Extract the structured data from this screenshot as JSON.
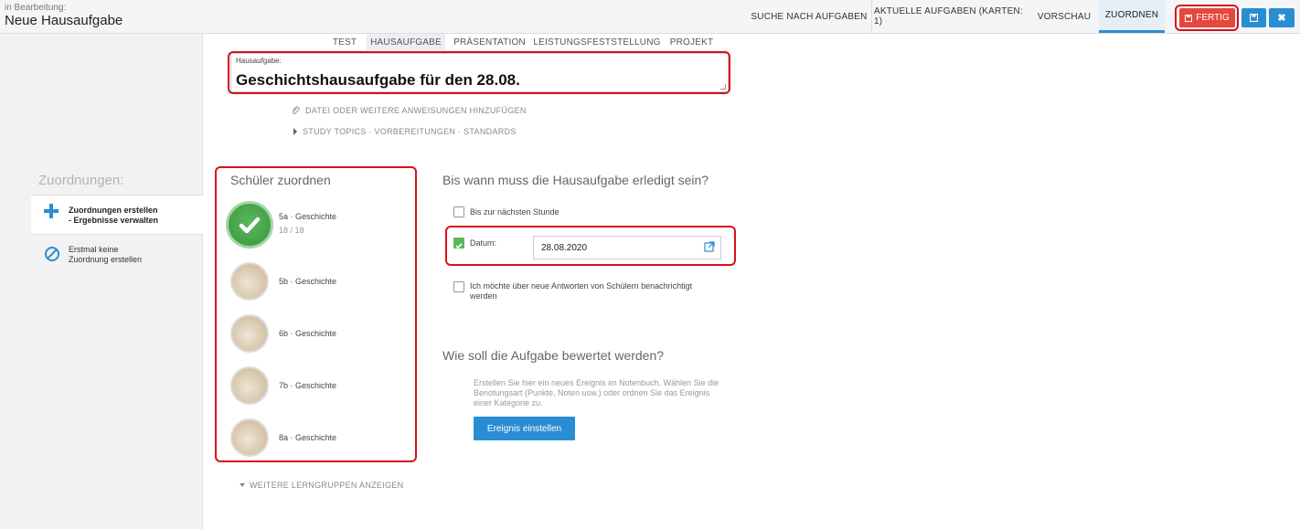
{
  "header": {
    "edit_status": "in Bearbeitung:",
    "title": "Neue Hausaufgabe",
    "nav": [
      {
        "label": "SUCHE NACH AUFGABEN"
      },
      {
        "label": "AKTUELLE AUFGABEN (KARTEN: 1)"
      },
      {
        "label": "VORSCHAU"
      },
      {
        "label": "ZUORDNEN",
        "active": true
      }
    ],
    "done_label": "FERTIG",
    "save_icon": "floppy-disk-icon",
    "close_icon": "close-icon"
  },
  "type_tabs": [
    {
      "label": "TEST"
    },
    {
      "label": "HAUSAUFGABE",
      "active": true
    },
    {
      "label": "PRÄSENTATION"
    },
    {
      "label": "LEISTUNGSFESTSTELLUNG"
    },
    {
      "label": "PROJEKT"
    }
  ],
  "task": {
    "field_label": "Hausaufgabe:",
    "title_value": "Geschichtshausaufgabe für den 28.08.",
    "attach_link": "DATEI ODER WEITERE ANWEISUNGEN HINZUFÜGEN",
    "topics_link": "STUDY TOPICS · VORBEREITUNGEN · STANDARDS"
  },
  "sidebar": {
    "heading": "Zuordnungen:",
    "items": [
      {
        "line1": "Zuordnungen erstellen",
        "line2": "- Ergebnisse verwalten",
        "icon": "plus-icon",
        "active": true
      },
      {
        "line1": "Erstmal keine",
        "line2": "Zuordnung erstellen",
        "icon": "prohibited-icon"
      }
    ]
  },
  "students": {
    "heading": "Schüler zuordnen",
    "groups": [
      {
        "name": "5a · Geschichte",
        "count": "18 / 18",
        "assigned": true
      },
      {
        "name": "5b · Geschichte"
      },
      {
        "name": "6b · Geschichte"
      },
      {
        "name": "7b · Geschichte"
      },
      {
        "name": "8a · Geschichte"
      }
    ],
    "more_link": "WEITERE LERNGRUPPEN ANZEIGEN"
  },
  "due": {
    "heading": "Bis wann muss die Hausaufgabe erledigt sein?",
    "next_lesson_label": "Bis zur nächsten Stunde",
    "next_lesson_checked": false,
    "date_label": "Datum:",
    "date_checked": true,
    "date_value": "28.08.2020",
    "notify_line1": "Ich möchte über neue Antworten von Schülern benachrichtigt",
    "notify_line2": "werden",
    "notify_checked": false
  },
  "grading": {
    "heading": "Wie soll die Aufgabe bewertet werden?",
    "desc_line1": "Erstellen Sie hier ein neues Ereignis im Notenbuch. Wählen Sie die",
    "desc_line2": "Benotungsart (Punkte, Noten usw.) oder ordnen Sie das Ereignis",
    "desc_line3": "einer Kategorie zu.",
    "button_label": "Ereignis einstellen"
  },
  "colors": {
    "accent": "#2a8dd4",
    "done_button": "#e6473c",
    "assigned_green": "#5cb85c",
    "highlight_red": "#d9101c"
  }
}
